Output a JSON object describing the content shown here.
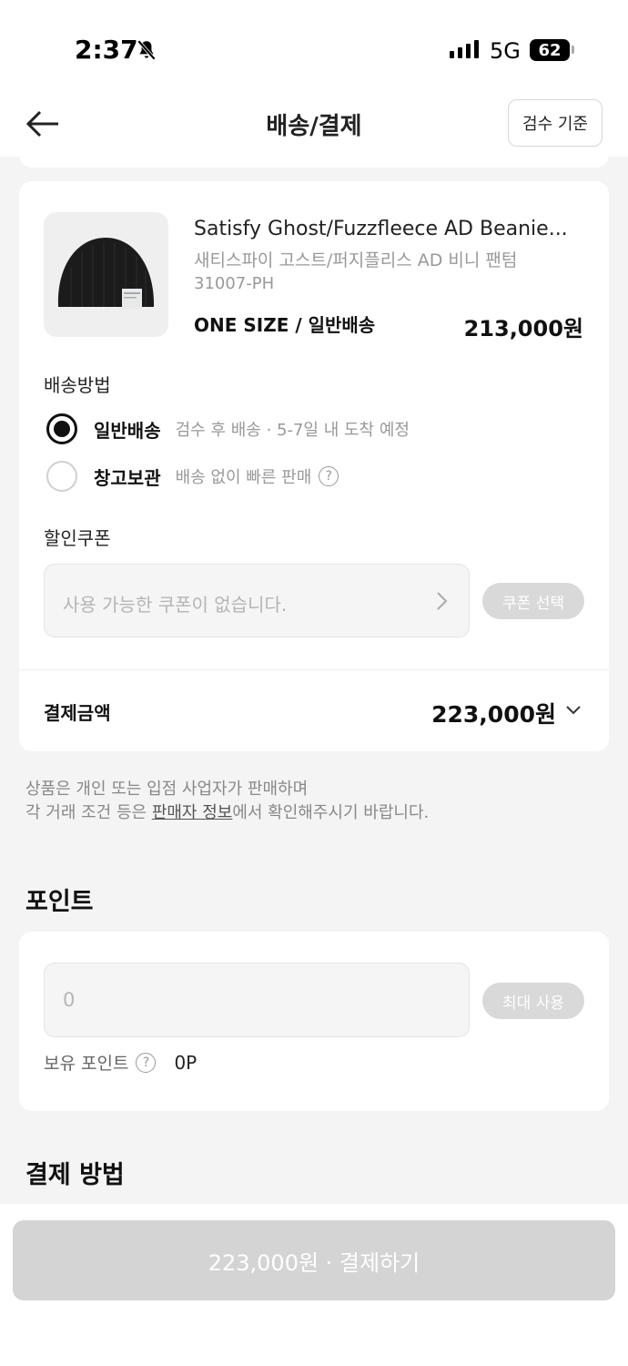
{
  "status": {
    "time": "2:37",
    "network": "5G",
    "battery": "62"
  },
  "header": {
    "title": "배송/결제",
    "criteria_label": "검수 기준"
  },
  "product": {
    "name": "Satisfy Ghost/Fuzzfleece AD Beanie...",
    "name_ko": "새티스파이 고스트/퍼지플리스 AD 비니 팬텀",
    "code": "31007-PH",
    "size_option": "ONE SIZE / 일반배송",
    "price": "213,000원"
  },
  "shipping": {
    "label": "배송방법",
    "options": [
      {
        "label": "일반배송",
        "sub": "검수 후 배송 · 5-7일 내 도착 예정",
        "selected": true
      },
      {
        "label": "창고보관",
        "sub": "배송 없이 빠른 판매",
        "selected": false
      }
    ]
  },
  "coupon": {
    "label": "할인쿠폰",
    "placeholder": "사용 가능한 쿠폰이 없습니다.",
    "button": "쿠폰 선택"
  },
  "total": {
    "label": "결제금액",
    "value": "223,000원"
  },
  "notice": {
    "line1": "상품은 개인 또는 입점 사업자가 판매하며",
    "line2_prefix": "각 거래 조건 등은 ",
    "line2_link": "판매자 정보",
    "line2_suffix": "에서 확인해주시기 바랍니다."
  },
  "points": {
    "title": "포인트",
    "input_value": "0",
    "button": "최대 사용",
    "owned_label": "보유 포인트",
    "owned_value": "0P"
  },
  "payment": {
    "title": "결제 방법",
    "button": "223,000원 · 결제하기"
  },
  "colors": {
    "background": "#f4f4f4",
    "card": "#ffffff",
    "disabled": "#d4d4d4"
  }
}
